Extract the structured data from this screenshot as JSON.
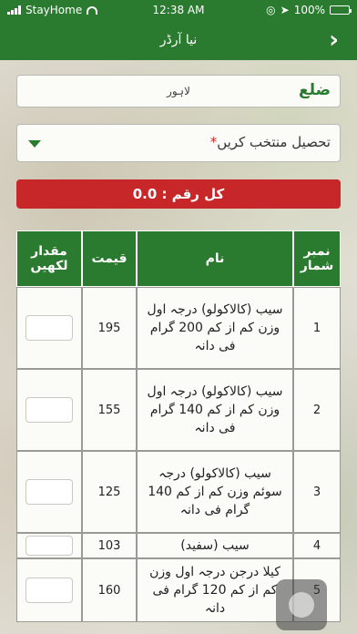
{
  "status_bar": {
    "carrier": "StayHome",
    "time": "12:38 AM",
    "battery": "100%"
  },
  "header": {
    "title": "نیا آرڈر",
    "back_glyph": "›"
  },
  "district": {
    "label": "ضلع",
    "value": "لاہور"
  },
  "tehsil": {
    "placeholder": "تحصیل منتخب کریں",
    "required_mark": "*"
  },
  "total": {
    "text": "کل رقم : 0.0"
  },
  "table": {
    "headers": {
      "qty": "مقدار لکھیں",
      "price": "قیمت",
      "name": "نام",
      "serial": "نمبر شمار"
    },
    "rows": [
      {
        "serial": "1",
        "name": "سیب (کالاکولو) درجہ اول وزن کم از کم 200 گرام فی دانہ",
        "price": "195"
      },
      {
        "serial": "2",
        "name": "سیب (کالاکولو) درجہ اول وزن کم از کم 140 گرام فی دانہ",
        "price": "155"
      },
      {
        "serial": "3",
        "name": "سیب (کالاکولو) درجہ سوئم وزن کم از کم 140 گرام فی دانہ",
        "price": "125"
      },
      {
        "serial": "4",
        "name": "سیب (سفید)",
        "price": "103"
      },
      {
        "serial": "5",
        "name": "کیلا درجن درجہ اول وزن کم از کم 120 گرام فی دانہ",
        "price": "160"
      }
    ]
  }
}
